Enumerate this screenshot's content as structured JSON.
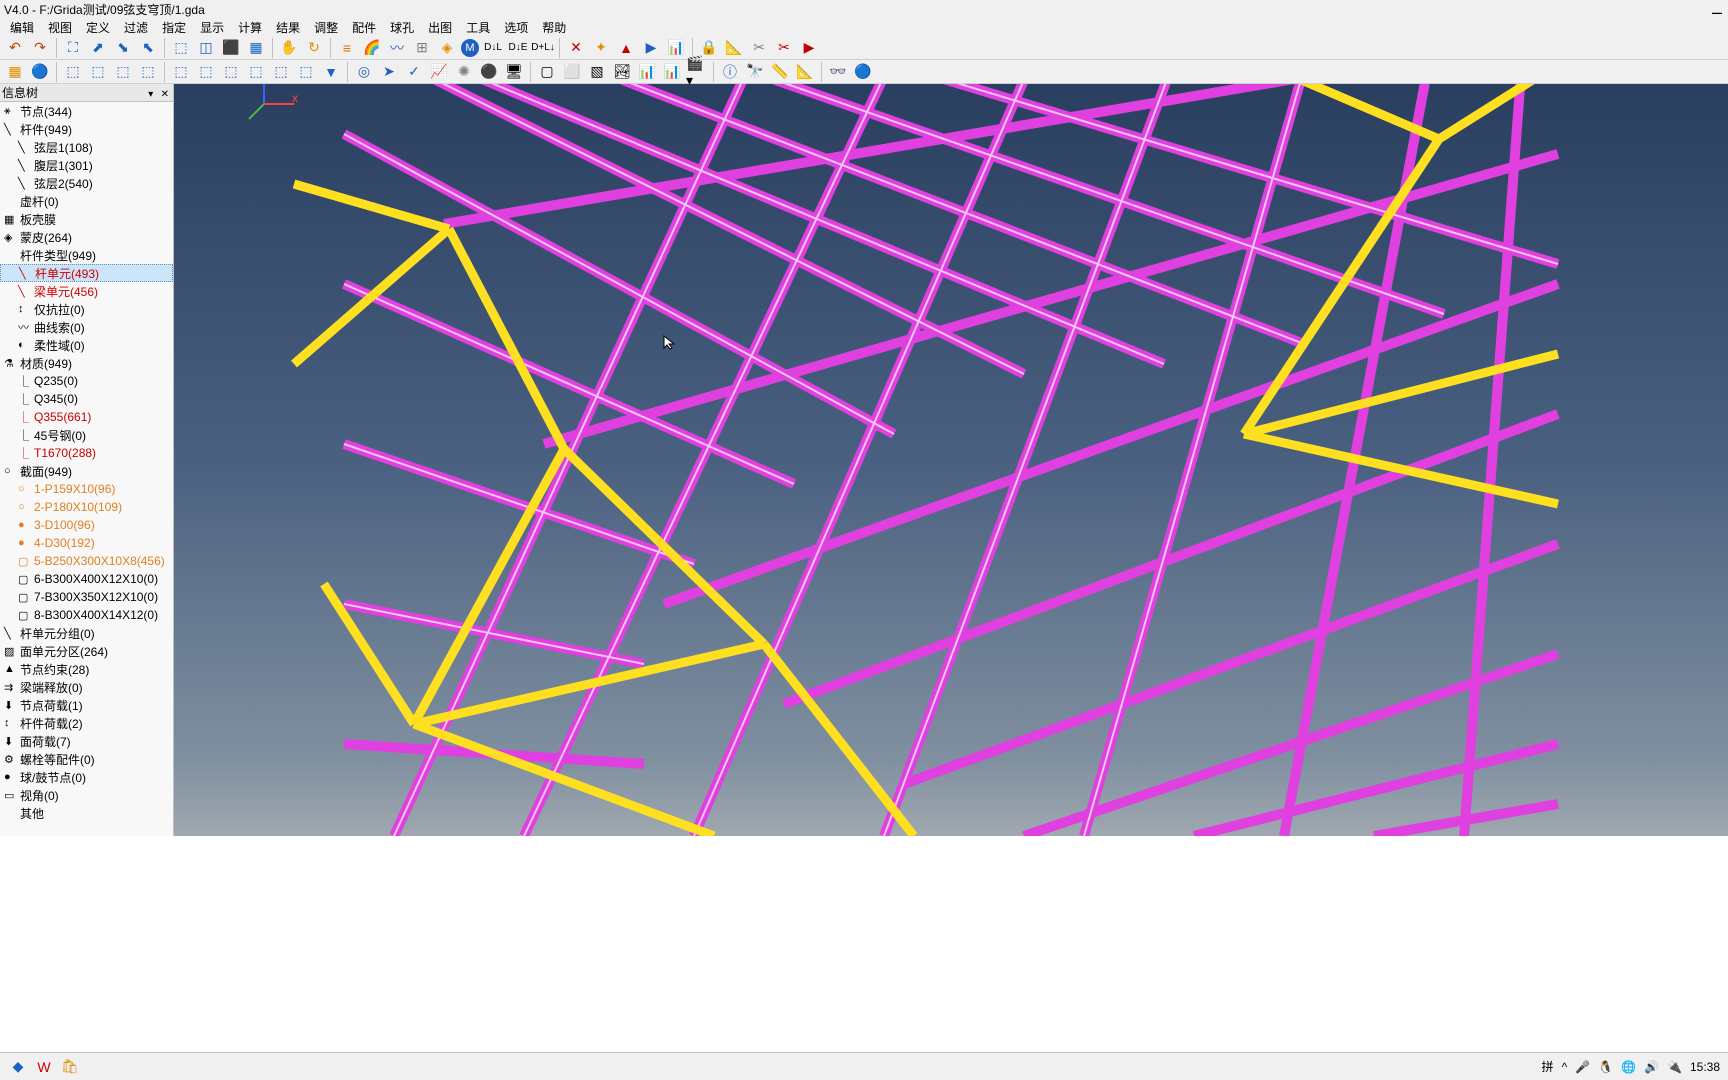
{
  "title": "V4.0 - F:/Grida测试/09弦支穹顶/1.gda",
  "menu": [
    "编辑",
    "视图",
    "定义",
    "过滤",
    "指定",
    "显示",
    "计算",
    "结果",
    "调整",
    "配件",
    "球孔",
    "出图",
    "工具",
    "选项",
    "帮助"
  ],
  "tree_header": "信息树",
  "tree": [
    {
      "icon": "⚹",
      "label": "节点(344)",
      "indent": 0
    },
    {
      "icon": "╲",
      "label": "杆件(949)",
      "indent": 0
    },
    {
      "icon": "╲",
      "label": "弦层1(108)",
      "indent": 1
    },
    {
      "icon": "╲",
      "label": "腹层1(301)",
      "indent": 1
    },
    {
      "icon": "╲",
      "label": "弦层2(540)",
      "indent": 1
    },
    {
      "icon": "",
      "label": "虚杆(0)",
      "indent": 0
    },
    {
      "icon": "▦",
      "label": "板壳膜",
      "indent": 0
    },
    {
      "icon": "◈",
      "label": "蒙皮(264)",
      "indent": 0
    },
    {
      "icon": "",
      "label": "杆件类型(949)",
      "indent": 0
    },
    {
      "icon": "╲",
      "label": "杆单元(493)",
      "indent": 1,
      "cls": "selected red"
    },
    {
      "icon": "╲",
      "label": "梁单元(456)",
      "indent": 1,
      "cls": "red"
    },
    {
      "icon": "↕",
      "label": "仅抗拉(0)",
      "indent": 1
    },
    {
      "icon": "〰",
      "label": "曲线索(0)",
      "indent": 1
    },
    {
      "icon": "◐",
      "label": "柔性域(0)",
      "indent": 1
    },
    {
      "icon": "⚗",
      "label": "材质(949)",
      "indent": 0
    },
    {
      "icon": "⎿",
      "label": "Q235(0)",
      "indent": 1
    },
    {
      "icon": "⎿",
      "label": "Q345(0)",
      "indent": 1
    },
    {
      "icon": "⎿",
      "label": "Q355(661)",
      "indent": 1,
      "cls": "red"
    },
    {
      "icon": "⎿",
      "label": "45号钢(0)",
      "indent": 1
    },
    {
      "icon": "⎿",
      "label": "T1670(288)",
      "indent": 1,
      "cls": "red"
    },
    {
      "icon": "○",
      "label": "截面(949)",
      "indent": 0
    },
    {
      "icon": "○",
      "label": "1-P159X10(96)",
      "indent": 1,
      "cls": "orange"
    },
    {
      "icon": "○",
      "label": "2-P180X10(109)",
      "indent": 1,
      "cls": "orange"
    },
    {
      "icon": "●",
      "label": "3-D100(96)",
      "indent": 1,
      "cls": "orange"
    },
    {
      "icon": "●",
      "label": "4-D30(192)",
      "indent": 1,
      "cls": "orange"
    },
    {
      "icon": "▢",
      "label": "5-B250X300X10X8(456)",
      "indent": 1,
      "cls": "orange"
    },
    {
      "icon": "▢",
      "label": "6-B300X400X12X10(0)",
      "indent": 1
    },
    {
      "icon": "▢",
      "label": "7-B300X350X12X10(0)",
      "indent": 1
    },
    {
      "icon": "▢",
      "label": "8-B300X400X14X12(0)",
      "indent": 1
    },
    {
      "icon": "╲",
      "label": "杆单元分组(0)",
      "indent": 0
    },
    {
      "icon": "▨",
      "label": "面单元分区(264)",
      "indent": 0
    },
    {
      "icon": "▲",
      "label": "节点约束(28)",
      "indent": 0
    },
    {
      "icon": "⇉",
      "label": "梁端释放(0)",
      "indent": 0
    },
    {
      "icon": "⬇",
      "label": "节点荷载(1)",
      "indent": 0
    },
    {
      "icon": "↕",
      "label": "杆件荷载(2)",
      "indent": 0
    },
    {
      "icon": "⬇",
      "label": "面荷载(7)",
      "indent": 0
    },
    {
      "icon": "⚙",
      "label": "螺栓等配件(0)",
      "indent": 0
    },
    {
      "icon": "●",
      "label": "球/鼓节点(0)",
      "indent": 0
    },
    {
      "icon": "▭",
      "label": "视角(0)",
      "indent": 0
    },
    {
      "icon": "",
      "label": "其他",
      "indent": 0
    }
  ],
  "ime": "拼",
  "time": "15:38"
}
